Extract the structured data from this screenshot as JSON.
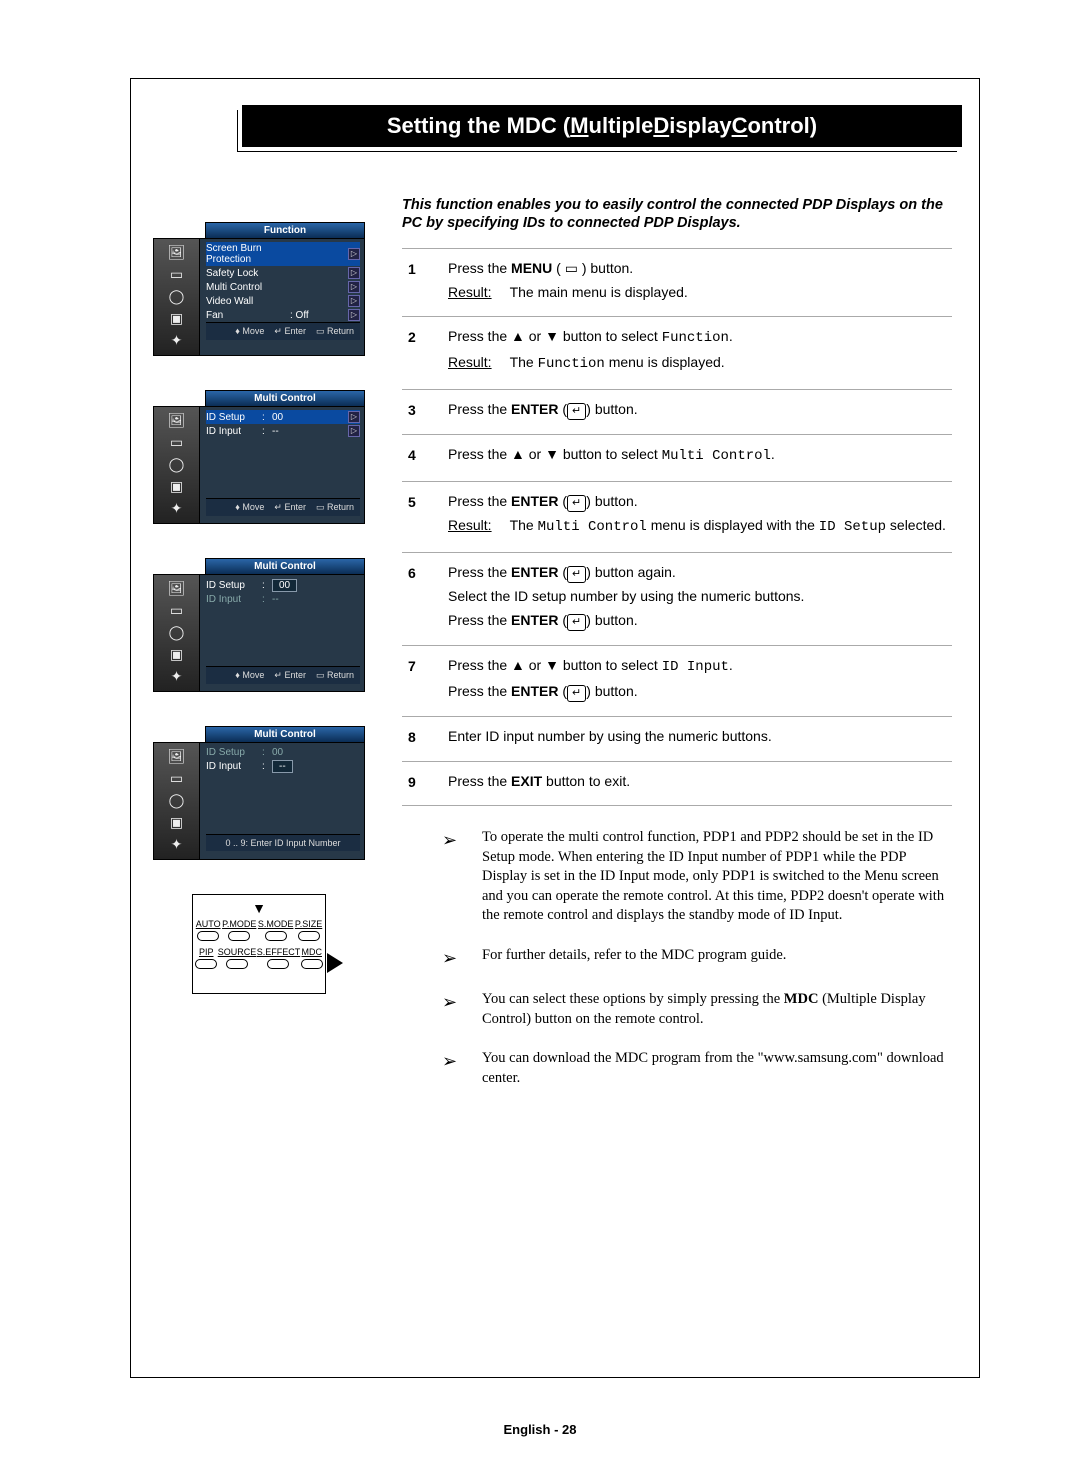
{
  "title_parts": [
    "Setting the MDC (",
    "M",
    "ultiple ",
    "D",
    "isplay ",
    "C",
    "ontrol)"
  ],
  "intro": "This function enables you to easily control the connected PDP Displays on the PC by specifying IDs to connected PDP Displays.",
  "osd_nav": {
    "move": "Move",
    "enter": "Enter",
    "return": "Return"
  },
  "osd1": {
    "header": "Function",
    "rows": [
      {
        "label": "Screen Burn Protection",
        "value": "",
        "arrow": true,
        "selected": true
      },
      {
        "label": "Safety Lock",
        "value": "",
        "arrow": true
      },
      {
        "label": "Multi Control",
        "value": "",
        "arrow": true
      },
      {
        "label": "Video Wall",
        "value": "",
        "arrow": true
      },
      {
        "label": "Fan",
        "value": ": Off",
        "arrow": true
      }
    ]
  },
  "osd2": {
    "header": "Multi Control",
    "rows": [
      {
        "label": "ID Setup",
        "sep": ":",
        "value": "00",
        "arrow": true,
        "selected": true
      },
      {
        "label": "ID Input",
        "sep": ":",
        "value": "--",
        "arrow": true
      }
    ]
  },
  "osd3": {
    "header": "Multi Control",
    "rows": [
      {
        "label": "ID Setup",
        "sep": ":",
        "value_box": "00"
      },
      {
        "label": "ID Input",
        "sep": ":",
        "value": "--"
      }
    ]
  },
  "osd4": {
    "header": "Multi Control",
    "rows": [
      {
        "label": "ID Setup",
        "sep": ":",
        "value": "00"
      },
      {
        "label": "ID Input",
        "sep": ":",
        "value_box": "--"
      }
    ],
    "footer": "0 .. 9: Enter ID Input Number"
  },
  "remote": {
    "row1": [
      "AUTO",
      "P.MODE",
      "S.MODE",
      "P.SIZE"
    ],
    "row2": [
      "PIP",
      "SOURCE",
      "S.EFFECT",
      "MDC"
    ]
  },
  "steps": [
    {
      "n": "1",
      "lines": [
        {
          "html": "Press the <b>MENU</b> ( ▭ ) button."
        },
        {
          "result": true,
          "text": "The main menu is displayed."
        }
      ]
    },
    {
      "n": "2",
      "lines": [
        {
          "html": "Press the ▲ or ▼ button to select <span class='mono'>Function</span>."
        },
        {
          "result": true,
          "html": "The <span class='mono'>Function</span> menu is displayed."
        }
      ]
    },
    {
      "n": "3",
      "lines": [
        {
          "html": "Press the <b>ENTER</b> (<span class='enter-glyph'>↵</span>) button."
        }
      ]
    },
    {
      "n": "4",
      "lines": [
        {
          "html": "Press the ▲ or ▼ button to select <span class='mono'>Multi Control</span>."
        }
      ]
    },
    {
      "n": "5",
      "lines": [
        {
          "html": "Press the <b>ENTER</b> (<span class='enter-glyph'>↵</span>) button."
        },
        {
          "result": true,
          "html": "The <span class='mono'>Multi Control</span> menu is displayed with the <span class='mono'>ID Setup</span> selected."
        }
      ]
    },
    {
      "n": "6",
      "lines": [
        {
          "html": "Press the <b>ENTER</b> (<span class='enter-glyph'>↵</span>) button again."
        },
        {
          "html": "Select the ID setup number by using the numeric buttons."
        },
        {
          "html": "Press the <b>ENTER</b> (<span class='enter-glyph'>↵</span>) button."
        }
      ]
    },
    {
      "n": "7",
      "lines": [
        {
          "html": "Press the ▲ or ▼ button to select <span class='mono'>ID Input</span>."
        },
        {
          "html": "Press the <b>ENTER</b> (<span class='enter-glyph'>↵</span>) button."
        }
      ]
    },
    {
      "n": "8",
      "lines": [
        {
          "html": "Enter ID input number by using the numeric buttons."
        }
      ]
    },
    {
      "n": "9",
      "last": true,
      "lines": [
        {
          "html": "Press the <b>EXIT</b> button to exit."
        }
      ]
    }
  ],
  "result_label": "Result:",
  "notes": [
    "To operate the multi control function, PDP1 and PDP2 should be set in the ID Setup mode. When entering the ID Input number of PDP1 while the PDP Display is set in the ID Input mode, only PDP1 is switched to the Menu screen and you can operate the remote control. At this time, PDP2 doesn't operate with the remote control and displays the standby mode of ID Input.",
    "For further details, refer to the MDC program guide.",
    "You can select these options by simply pressing the <b>MDC</b> (Multiple Display Control) button on the remote control.",
    "You can download the MDC program from the \"www.samsung.com\" download center."
  ],
  "footer": "English - 28"
}
